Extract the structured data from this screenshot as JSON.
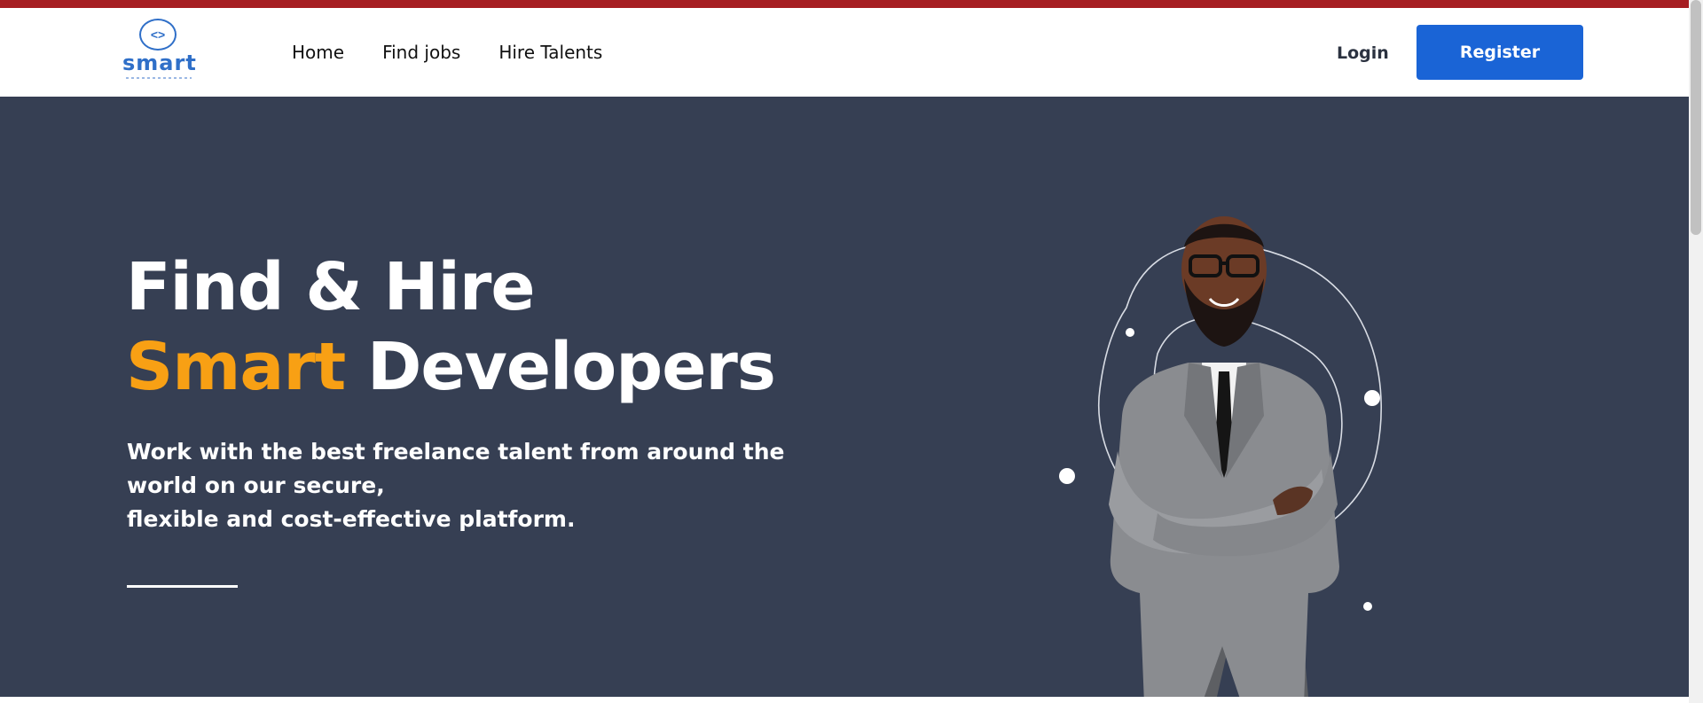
{
  "brand": {
    "logo_glyph": "<>",
    "name": "smart"
  },
  "nav": {
    "items": [
      "Home",
      "Find jobs",
      "Hire Talents"
    ]
  },
  "auth": {
    "login_label": "Login",
    "register_label": "Register"
  },
  "hero": {
    "title_line1": "Find & Hire",
    "title_accent": "Smart",
    "title_rest": " Developers",
    "subtitle_line1": "Work with the best freelance talent from around the world on our secure,",
    "subtitle_line2": "flexible and cost-effective platform."
  },
  "colors": {
    "top_stripe": "#a61e22",
    "hero_bg": "#363f53",
    "accent": "#f8a014",
    "primary": "#1a64d6",
    "brand": "#2f6fc8"
  },
  "icons": {
    "logo": "code-brackets-icon"
  }
}
